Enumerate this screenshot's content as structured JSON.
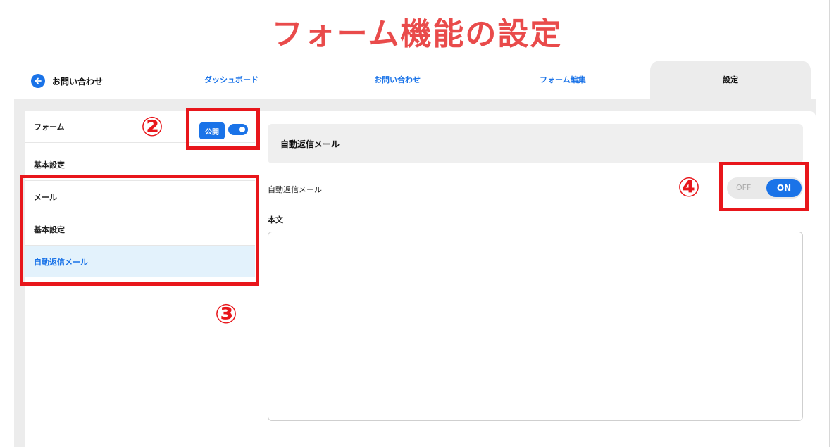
{
  "headline": "フォーム機能の設定",
  "nav": {
    "back_label": "お問い合わせ",
    "tabs": [
      {
        "label": "ダッシュボード"
      },
      {
        "label": "お問い合わせ"
      },
      {
        "label": "フォーム編集"
      },
      {
        "label": "設定",
        "active": true
      }
    ]
  },
  "sidebar": {
    "form_label": "フォーム",
    "publish_badge": "公開",
    "publish_on": true,
    "items": [
      {
        "label": "基本設定"
      },
      {
        "label": "メール"
      },
      {
        "label": "基本設定"
      },
      {
        "label": "自動返信メール",
        "active": true
      }
    ]
  },
  "main": {
    "section_title": "自動返信メール",
    "field_label": "自動返信メール",
    "toggle_off": "OFF",
    "toggle_on": "ON",
    "toggle_state": "ON",
    "body_label": "本文",
    "body_value": ""
  },
  "annotations": {
    "n2": "②",
    "n3": "③",
    "n4": "④"
  },
  "colors": {
    "accent": "#1a73e8",
    "highlight": "#e8161b",
    "headline": "#e94b4b",
    "active_row": "#e3f2fc"
  }
}
